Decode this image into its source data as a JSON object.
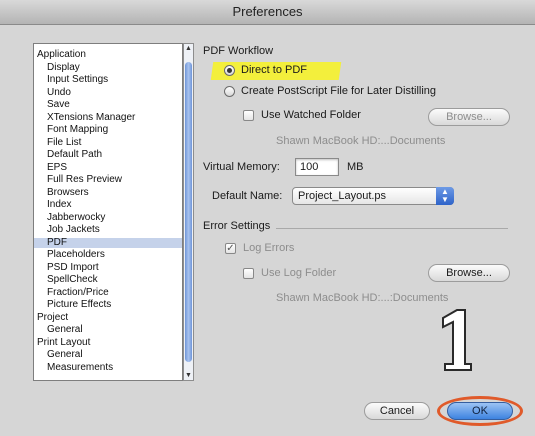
{
  "window": {
    "title": "Preferences"
  },
  "sidebar": {
    "items": [
      "Application",
      "Display",
      "Input Settings",
      "Undo",
      "Save",
      "XTensions Manager",
      "Font Mapping",
      "File List",
      "Default Path",
      "EPS",
      "Full Res Preview",
      "Browsers",
      "Index",
      "Jabberwocky",
      "Job Jackets",
      "PDF",
      "Placeholders",
      "PSD Import",
      "SpellCheck",
      "Fraction/Price",
      "Picture Effects",
      "Project",
      "General",
      "Print Layout",
      "General",
      "Measurements"
    ],
    "selected": "PDF"
  },
  "pdf": {
    "section_label": "PDF Workflow",
    "direct_to_pdf": "Direct to PDF",
    "create_postscript": "Create PostScript File for Later Distilling",
    "use_watched_folder": "Use Watched Folder",
    "browse1": "Browse...",
    "watched_path": "Shawn MacBook HD:...Documents",
    "virtual_memory_label": "Virtual Memory:",
    "virtual_memory_value": "100",
    "virtual_memory_unit": "MB",
    "default_name_label": "Default Name:",
    "default_name_value": "Project_Layout.ps"
  },
  "errors": {
    "section_label": "Error Settings",
    "log_errors": "Log Errors",
    "use_log_folder": "Use Log Folder",
    "browse2": "Browse...",
    "log_path": "Shawn MacBook HD:...:Documents"
  },
  "callout": {
    "number": "1"
  },
  "buttons": {
    "cancel": "Cancel",
    "ok": "OK"
  },
  "colors": {
    "highlight": "#f3ef3c",
    "ok_ring": "#e05a2a",
    "accent": "#3d83e0"
  }
}
